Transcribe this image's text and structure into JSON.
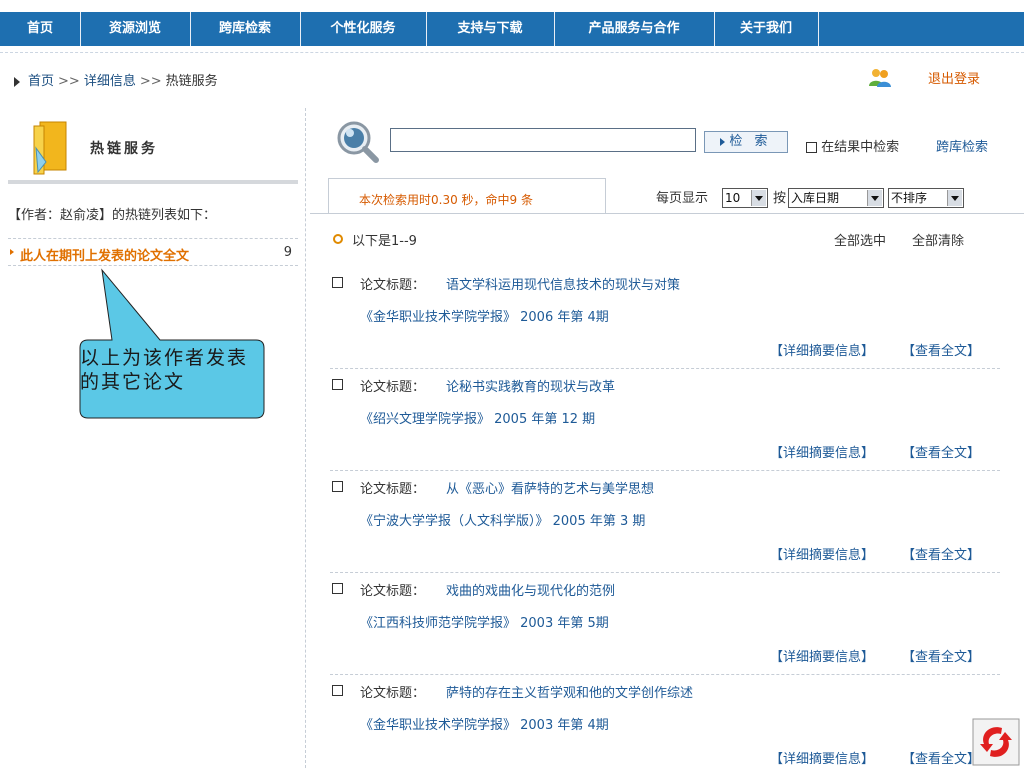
{
  "nav": [
    "首页",
    "资源浏览",
    "跨库检索",
    "个性化服务",
    "支持与下载",
    "产品服务与合作",
    "关于我们"
  ],
  "breadcrumb": {
    "home": "首页",
    "sep": ">>",
    "detail": "详细信息",
    "current": "热链服务"
  },
  "header": {
    "logout": "退出登录"
  },
  "left": {
    "title": "热链服务",
    "author_line": "【作者：赵俞凌】的热链列表如下：",
    "link_label": "此人在期刊上发表的论文全文",
    "link_count": "9",
    "callout": "以上为该作者发表的其它论文"
  },
  "search": {
    "value": "",
    "button": "检 索",
    "in_results": "在结果中检索",
    "cross_db": "跨库检索"
  },
  "tab": {
    "stats": "本次检索用时0.30 秒，命中9 条"
  },
  "paging": {
    "per_page_label": "每页显示",
    "per_page": "10",
    "by": "按",
    "sort_field": "入库日期",
    "sort_order": "不排序"
  },
  "results": {
    "range": "以下是1--9",
    "select_all": "全部选中",
    "clear_all": "全部清除",
    "title_label": "论文标题：",
    "detail_label": "【详细摘要信息】",
    "full_label": "【查看全文】",
    "items": [
      {
        "title": "语文学科运用现代信息技术的现状与对策",
        "journal": "《金华职业技术学院学报》 2006 年第 4期"
      },
      {
        "title": "论秘书实践教育的现状与改革",
        "journal": "《绍兴文理学院学报》 2005 年第 12 期"
      },
      {
        "title": "从《恶心》看萨特的艺术与美学思想",
        "journal": "《宁波大学学报（人文科学版）》 2005 年第 3 期"
      },
      {
        "title": "戏曲的戏曲化与现代化的范例",
        "journal": "《江西科技师范学院学报》 2003 年第 5期"
      },
      {
        "title": "萨特的存在主义哲学观和他的文学创作综述",
        "journal": "《金华职业技术学院学报》 2003 年第 4期"
      }
    ]
  },
  "colors": {
    "nav_bg": "#1E6FB0",
    "accent_orange": "#E07000",
    "link_blue": "#1E5A97",
    "callout_fill": "#5BC8E6"
  }
}
